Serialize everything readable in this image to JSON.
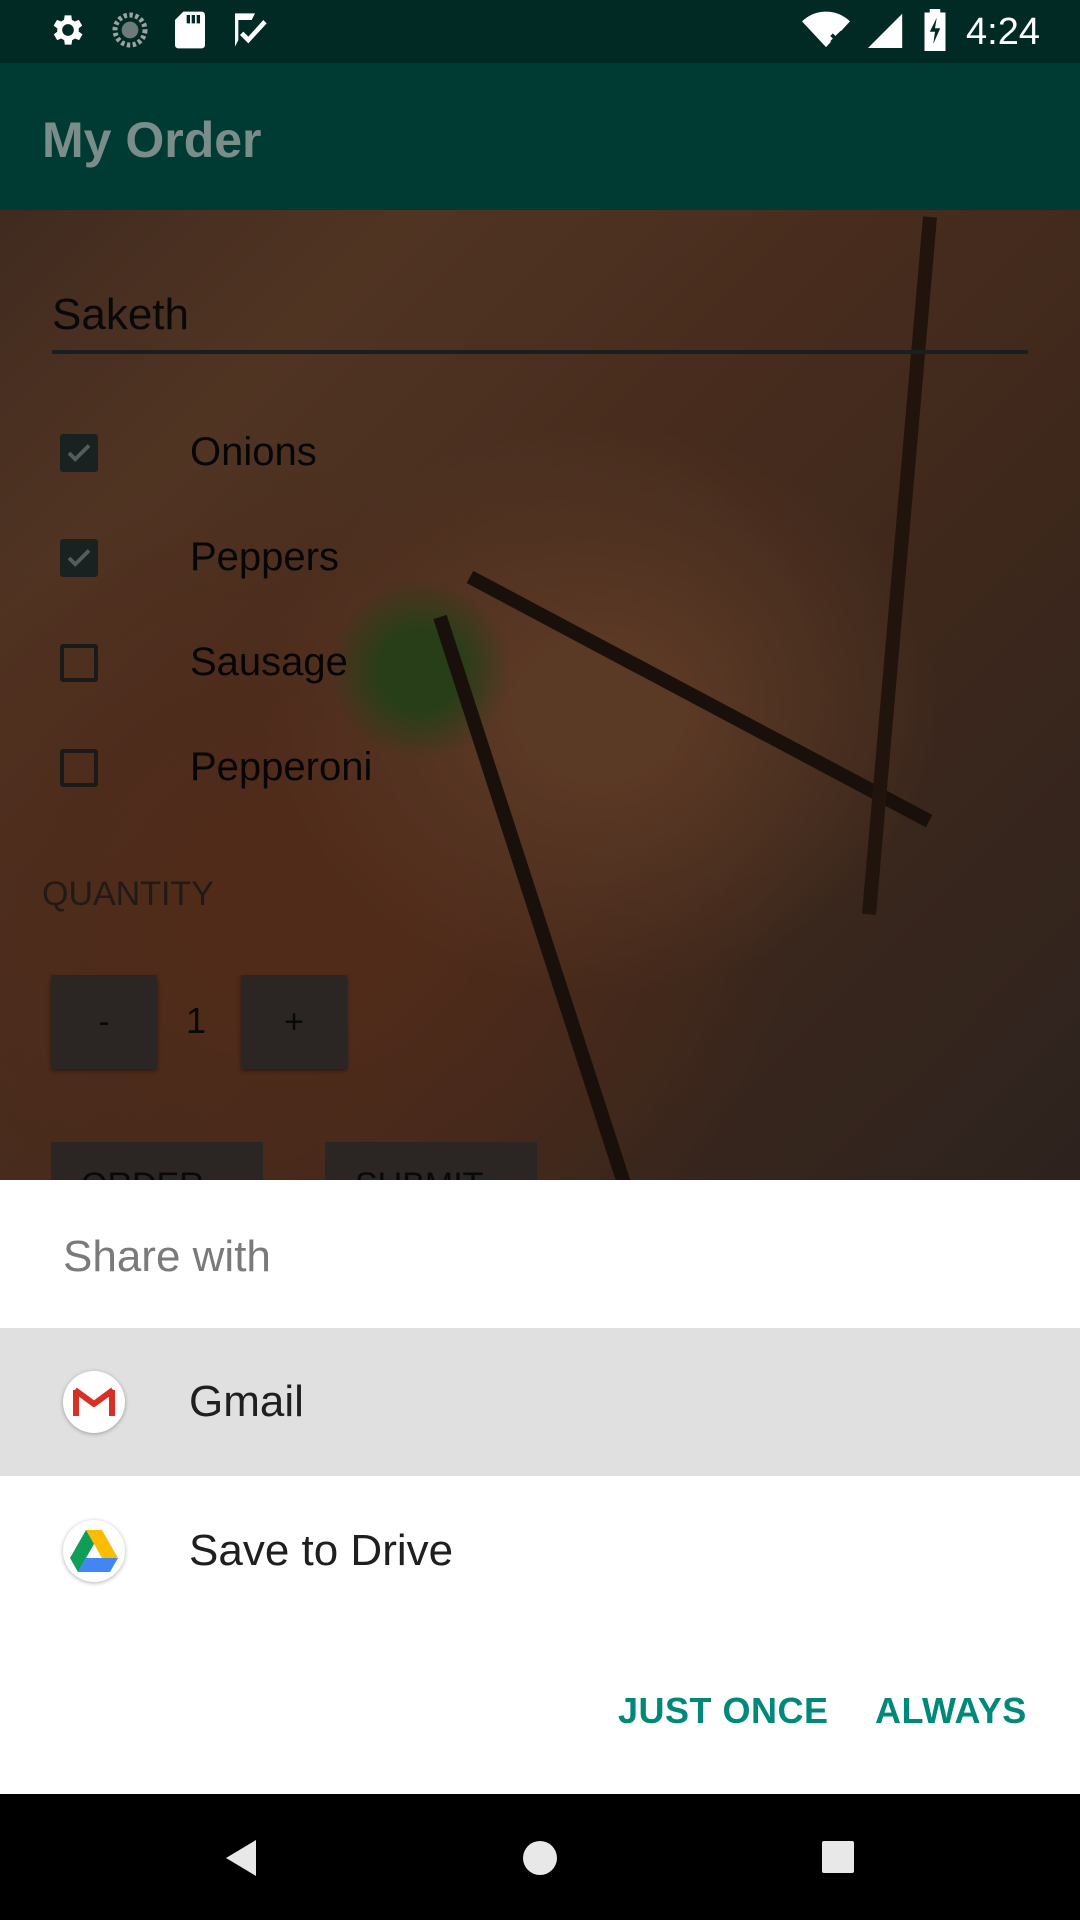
{
  "status_bar": {
    "time": "4:24",
    "icons_left": [
      "settings-icon",
      "sync-icon",
      "sd-card-icon",
      "checklist-icon"
    ],
    "icons_right": [
      "wifi-icon",
      "signal-icon",
      "battery-icon"
    ]
  },
  "app_bar": {
    "title": "My Order"
  },
  "form": {
    "name_value": "Saketh",
    "toppings": [
      {
        "label": "Onions",
        "checked": true
      },
      {
        "label": "Peppers",
        "checked": true
      },
      {
        "label": "Sausage",
        "checked": false
      },
      {
        "label": "Pepperoni",
        "checked": false
      }
    ],
    "quantity_header": "QUANTITY",
    "decrement_label": "-",
    "quantity": "1",
    "increment_label": "+",
    "order_label": "ORDER",
    "submit_label": "SUBMIT"
  },
  "share_sheet": {
    "title": "Share with",
    "apps": [
      {
        "label": "Gmail",
        "icon": "gmail-icon",
        "selected": true
      },
      {
        "label": "Save to Drive",
        "icon": "drive-icon",
        "selected": false
      }
    ],
    "just_once_label": "JUST ONCE",
    "always_label": "ALWAYS",
    "accent_color": "#00897b"
  },
  "nav_bar": {
    "icons": [
      "back-icon",
      "home-icon",
      "recents-icon"
    ]
  },
  "colors": {
    "status_bar": "#022a24",
    "app_bar": "#003b33"
  }
}
